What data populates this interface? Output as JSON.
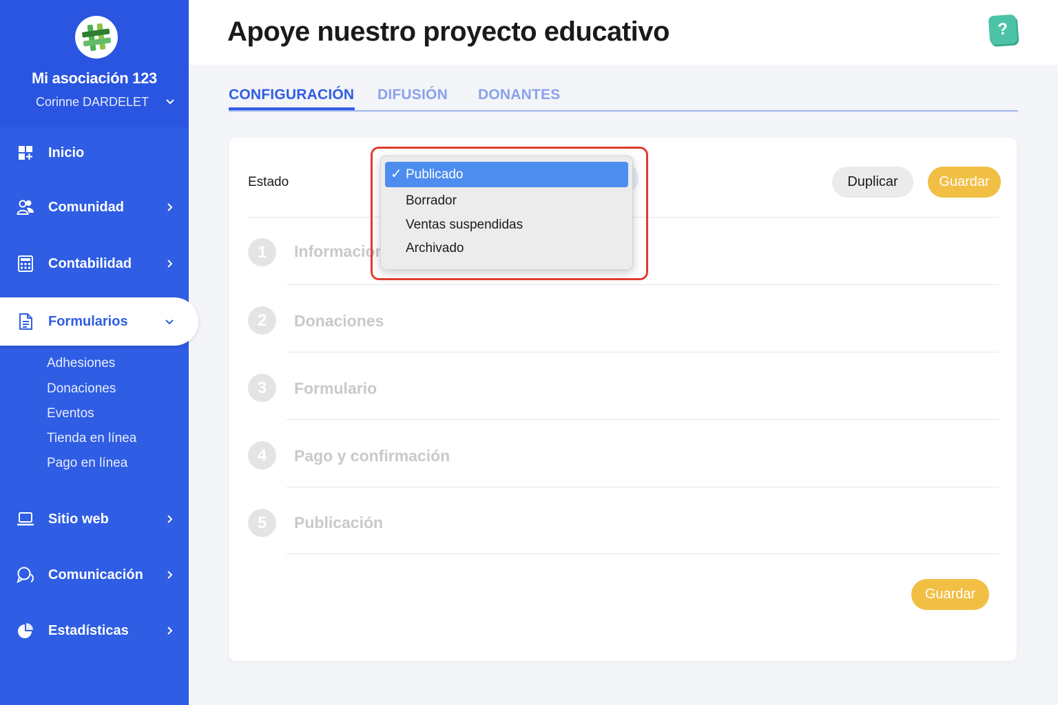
{
  "sidebar": {
    "org_name": "Mi asociación 123",
    "user_name": "Corinne DARDELET",
    "nav": [
      {
        "label": "Inicio",
        "icon": "dashboard-icon"
      },
      {
        "label": "Comunidad",
        "icon": "users-icon"
      },
      {
        "label": "Contabilidad",
        "icon": "calculator-icon"
      },
      {
        "label": "Formularios",
        "icon": "document-icon"
      },
      {
        "label": "Sitio web",
        "icon": "laptop-icon"
      },
      {
        "label": "Comunicación",
        "icon": "chat-icon"
      },
      {
        "label": "Estadísticas",
        "icon": "pie-chart-icon"
      }
    ],
    "sub_items": [
      "Adhesiones",
      "Donaciones",
      "Eventos",
      "Tienda en línea",
      "Pago en línea"
    ],
    "accent": "#2f5de3"
  },
  "header": {
    "title": "Apoye nuestro proyecto educativo",
    "help": "?"
  },
  "tabs": [
    {
      "label": "CONFIGURACIÓN"
    },
    {
      "label": "DIFUSIÓN"
    },
    {
      "label": "DONANTES"
    }
  ],
  "card": {
    "estado_label": "Estado",
    "duplicate_label": "Duplicar",
    "save_label": "Guardar",
    "steps": [
      {
        "num": "1",
        "label": "Informacion"
      },
      {
        "num": "2",
        "label": "Donaciones"
      },
      {
        "num": "3",
        "label": "Formulario"
      },
      {
        "num": "4",
        "label": "Pago y confirmación"
      },
      {
        "num": "5",
        "label": "Publicación"
      }
    ]
  },
  "dropdown": {
    "check": "✓",
    "options": [
      "Publicado",
      "Borrador",
      "Ventas suspendidas",
      "Archivado"
    ],
    "selected": "Publicado"
  }
}
